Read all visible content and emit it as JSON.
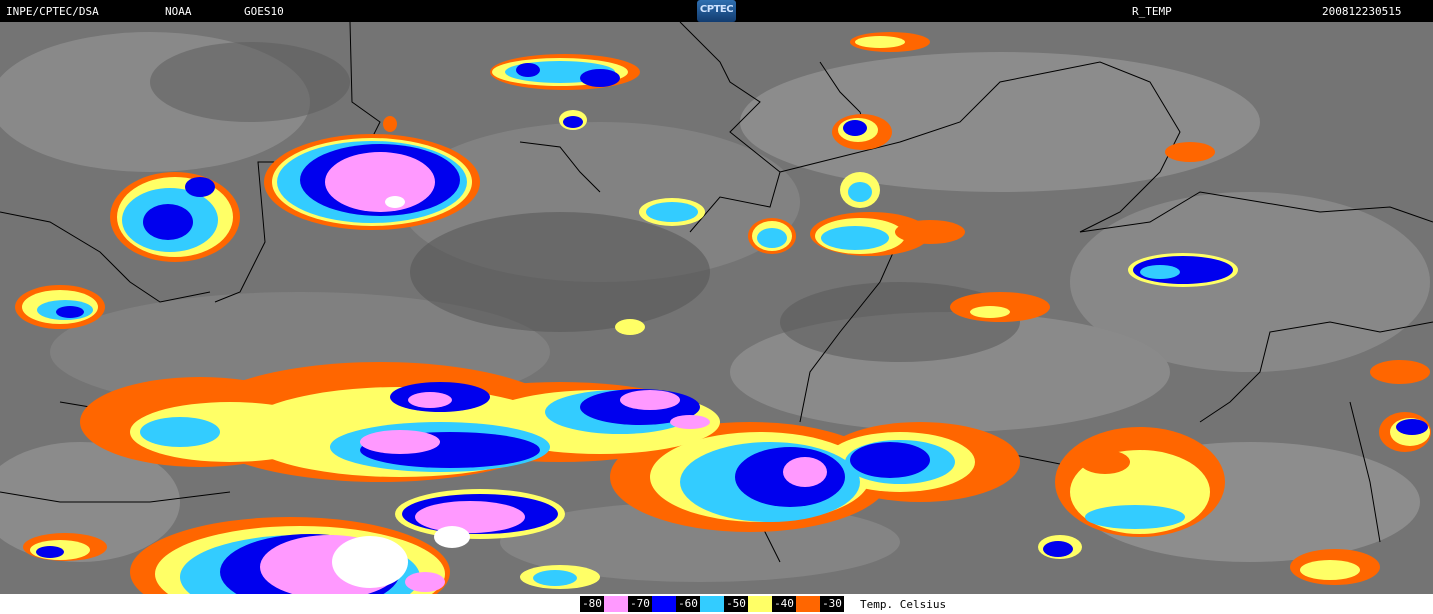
{
  "header": {
    "source": "INPE/CPTEC/DSA",
    "agency": "NOAA",
    "satellite": "GOES10",
    "logo_text": "CPTEC",
    "product": "R_TEMP",
    "timestamp": "200812230515"
  },
  "legend": {
    "items": [
      {
        "label": "-80",
        "color": "#ff99ff"
      },
      {
        "label": "-70",
        "color": "#0000ff"
      },
      {
        "label": "-60",
        "color": "#33ccff"
      },
      {
        "label": "-50",
        "color": "#ffff66"
      },
      {
        "label": "-40",
        "color": "#ff6600"
      },
      {
        "label": "-30",
        "color": "#ff6600"
      }
    ],
    "unit": "Temp. Celsius"
  },
  "colors": {
    "cloud_gray": "#8a8a8a",
    "land_dark": "#5a5a5a",
    "coldest": "#ffffff",
    "pink": "#ff99ff",
    "blue": "#0000ee",
    "cyan": "#33ccff",
    "yellow": "#ffff66",
    "orange": "#ff6600"
  }
}
